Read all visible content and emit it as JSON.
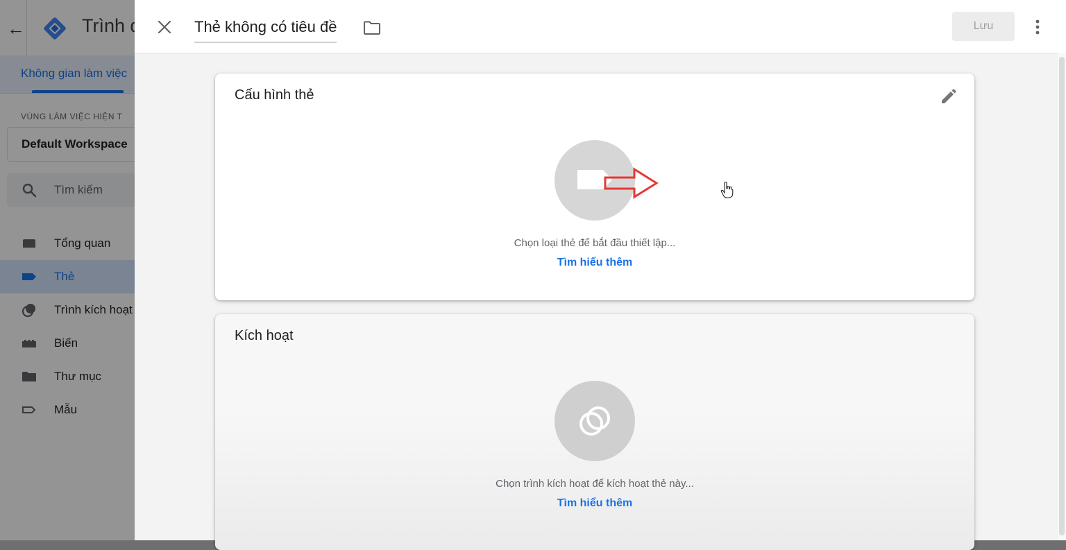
{
  "background": {
    "app_title": "Trình q",
    "workspace_tab": "Không gian làm việc",
    "workspace_section_label": "VÙNG LÀM VIỆC HIỆN T",
    "workspace_name": "Default Workspace",
    "search_placeholder": "Tìm kiếm",
    "nav": [
      {
        "label": "Tổng quan",
        "icon": "overview-icon"
      },
      {
        "label": "Thẻ",
        "icon": "tag-icon",
        "active": true
      },
      {
        "label": "Trình kích hoạt",
        "icon": "trigger-icon"
      },
      {
        "label": "Biến",
        "icon": "variable-icon"
      },
      {
        "label": "Thư mục",
        "icon": "folder-icon"
      },
      {
        "label": "Mẫu",
        "icon": "template-icon"
      }
    ]
  },
  "panel": {
    "title": "Thẻ không có tiêu đề",
    "save_label": "Lưu"
  },
  "tag_config": {
    "title": "Cấu hình thẻ",
    "hint": "Chọn loại thẻ để bắt đầu thiết lập...",
    "learn_more": "Tìm hiểu thêm"
  },
  "triggering": {
    "title": "Kích hoạt",
    "hint": "Chọn trình kích hoạt để kích hoạt thẻ này...",
    "learn_more": "Tìm hiểu thêm"
  },
  "colors": {
    "accent": "#1a73e8",
    "annotation_arrow": "#e53935",
    "circle": "#d6d6d6"
  }
}
